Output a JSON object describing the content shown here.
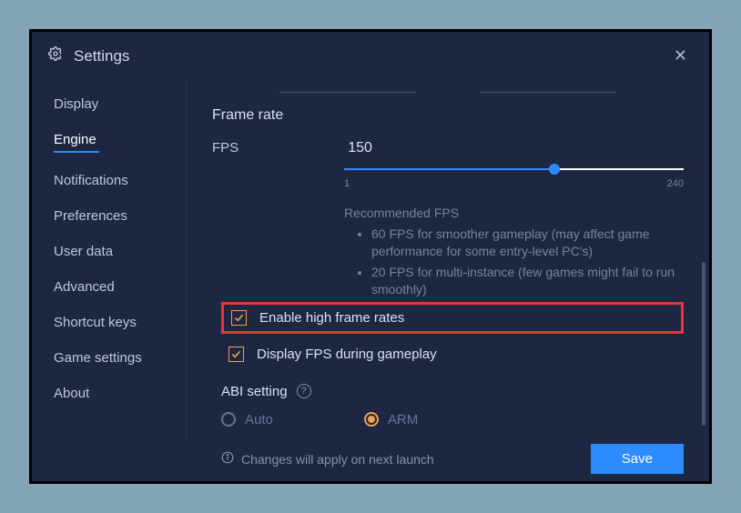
{
  "window": {
    "title": "Settings"
  },
  "sidebar": {
    "items": [
      {
        "label": "Display"
      },
      {
        "label": "Engine"
      },
      {
        "label": "Notifications"
      },
      {
        "label": "Preferences"
      },
      {
        "label": "User data"
      },
      {
        "label": "Advanced"
      },
      {
        "label": "Shortcut keys"
      },
      {
        "label": "Game settings"
      },
      {
        "label": "About"
      }
    ],
    "active_index": 1
  },
  "main": {
    "frame_rate": {
      "section_title": "Frame rate",
      "fps_label": "FPS",
      "fps_value": "150",
      "slider_min": "1",
      "slider_max": "240",
      "slider_fill_percent": 62,
      "recommended_title": "Recommended FPS",
      "recommendations": [
        "60 FPS for smoother gameplay (may affect game performance for some entry-level PC's)",
        "20 FPS for multi-instance (few games might fail to run smoothly)"
      ],
      "checkbox_high_fps": "Enable high frame rates",
      "checkbox_display_fps": "Display FPS during gameplay"
    },
    "abi": {
      "title": "ABI setting",
      "options": [
        {
          "label": "Auto",
          "selected": false
        },
        {
          "label": "ARM",
          "selected": true
        }
      ]
    }
  },
  "footer": {
    "note": "Changes will apply on next launch",
    "save_label": "Save"
  }
}
